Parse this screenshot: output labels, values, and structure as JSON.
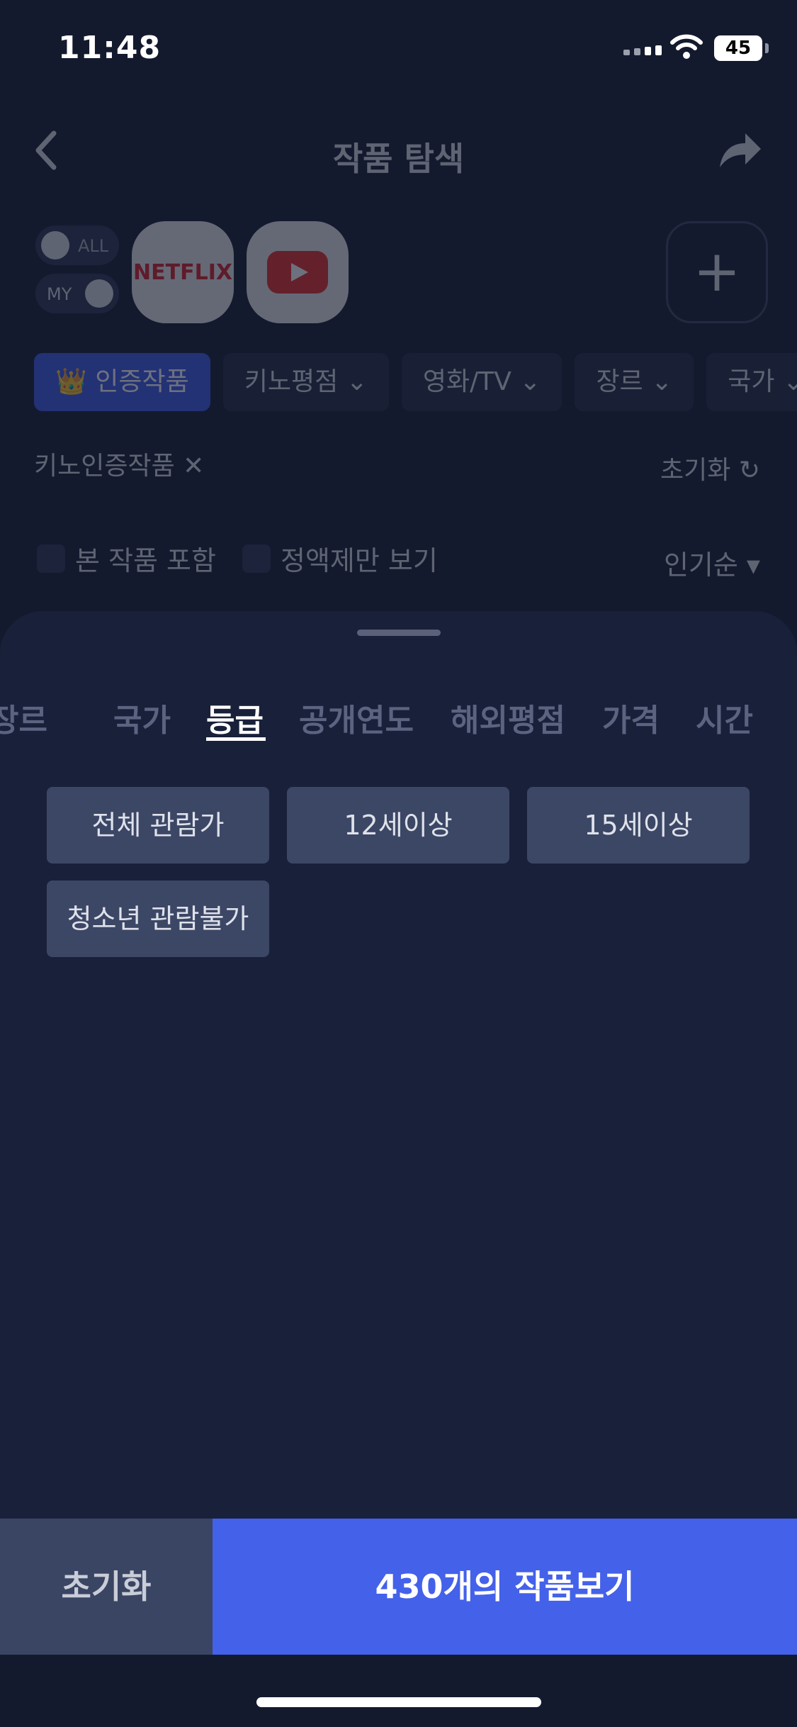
{
  "status_bar": {
    "time": "11:48",
    "battery": "45"
  },
  "header": {
    "title": "작품 탐색"
  },
  "toggles": {
    "top_label": "ALL",
    "bottom_label": "MY"
  },
  "ott": {
    "netflix_label": "NETFLIX"
  },
  "filter_chips": [
    {
      "label": "👑 인증작품",
      "active": true
    },
    {
      "label": "키노평점 ⌄"
    },
    {
      "label": "영화/TV ⌄"
    },
    {
      "label": "장르 ⌄"
    },
    {
      "label": "국가 ⌄"
    }
  ],
  "applied_filter": "키노인증작품 ✕",
  "reset_link": "초기화 ↻",
  "options": {
    "include_seen": "본 작품 포함",
    "flat_only": "정액제만 보기",
    "sort": "인기순 ▾"
  },
  "sheet": {
    "tabs": [
      "장르",
      "국가",
      "등급",
      "공개연도",
      "해외평점",
      "가격",
      "시간"
    ],
    "active_tab": "등급",
    "grades": [
      "전체 관람가",
      "12세이상",
      "15세이상",
      "청소년 관람불가"
    ]
  },
  "actions": {
    "reset": "초기화",
    "view": "430개의 작품보기"
  }
}
